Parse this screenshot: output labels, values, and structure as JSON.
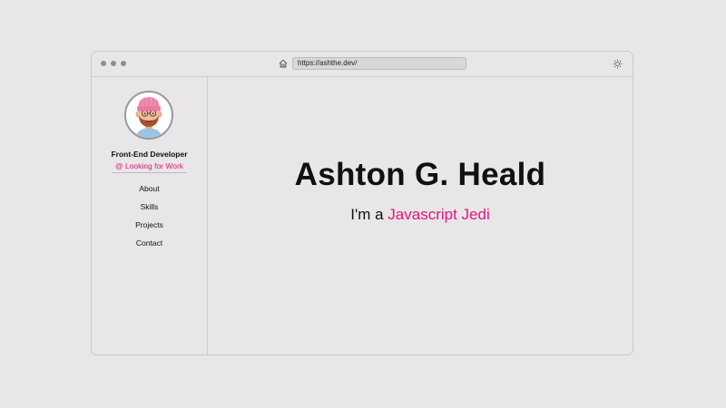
{
  "browser": {
    "url": "https://ashthe.dev/",
    "icons": {
      "home": "home-icon",
      "theme": "sun-icon"
    }
  },
  "sidebar": {
    "role": "Front-End Developer",
    "status": "@ Looking for Work",
    "nav": [
      {
        "label": "About"
      },
      {
        "label": "Skills"
      },
      {
        "label": "Projects"
      },
      {
        "label": "Contact"
      }
    ]
  },
  "hero": {
    "name": "Ashton G. Heald",
    "prefix": "I'm a ",
    "highlight": "Javascript Jedi"
  },
  "colors": {
    "accent": "#e4147c",
    "background": "#e8e6e8"
  }
}
